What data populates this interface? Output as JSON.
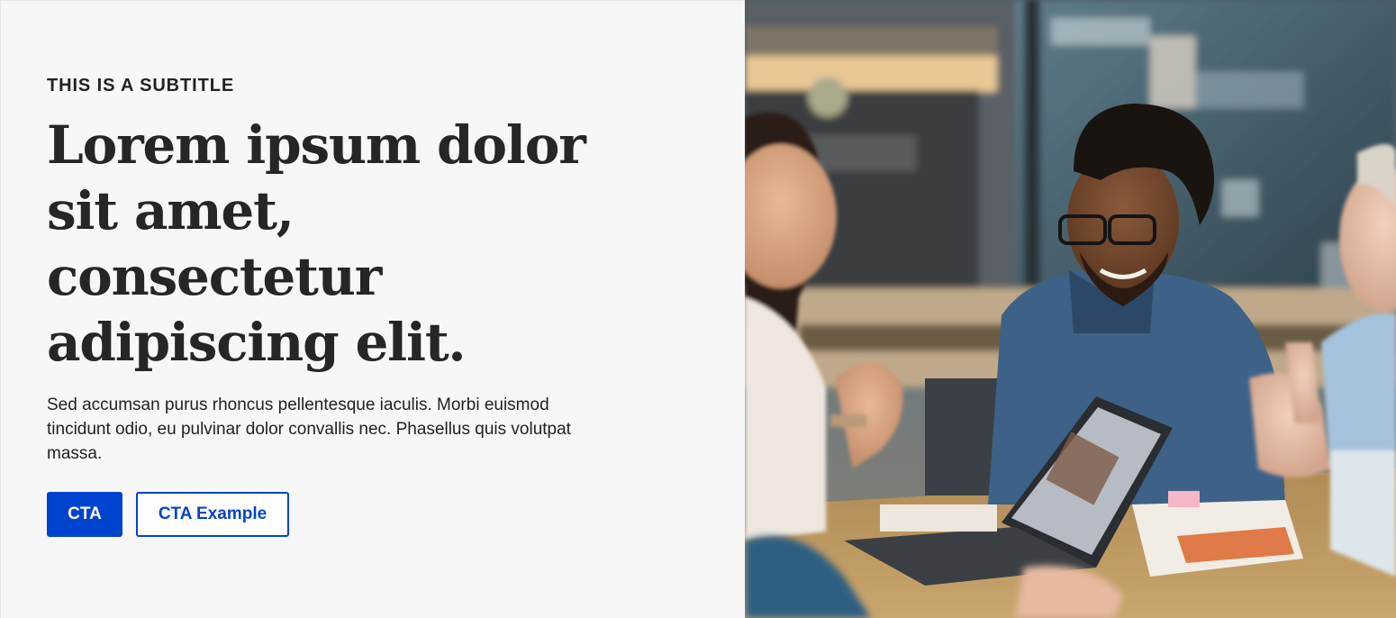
{
  "hero": {
    "subtitle": "THIS IS A SUBTITLE",
    "headline": "Lorem ipsum dolor sit amet, consectetur adipiscing elit.",
    "body": "Sed accumsan purus rhoncus pellentesque iaculis. Morbi euismod tincidunt odio, eu pulvinar dolor convallis nec. Phasellus quis volutpat massa.",
    "primary_cta": "CTA",
    "secondary_cta": "CTA Example"
  },
  "colors": {
    "brand_blue": "#0043ce",
    "background": "#f7f7f7",
    "text": "#222222"
  }
}
